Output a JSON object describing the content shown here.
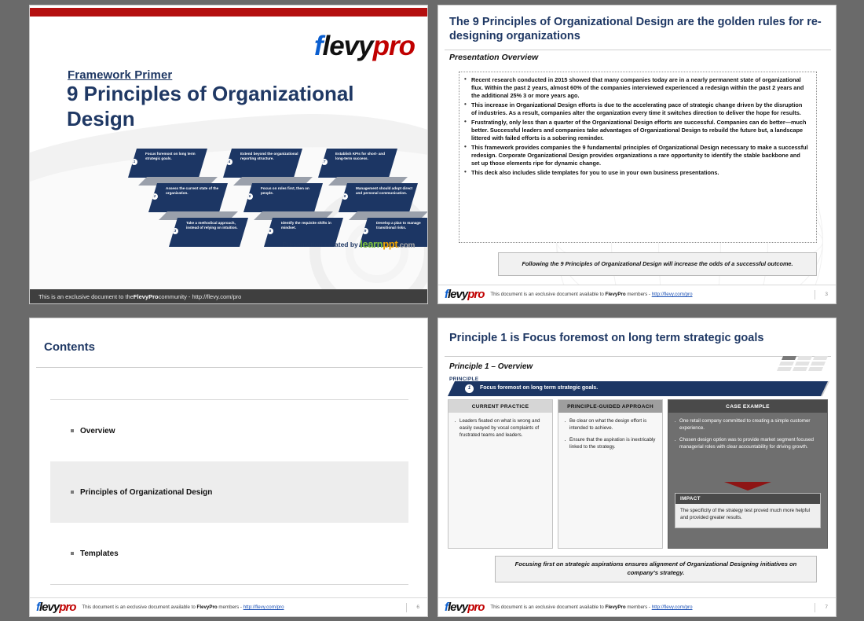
{
  "brand": {
    "flevy_f": "f",
    "flevy_levy": "levy",
    "flevy_pro": "pro",
    "learn": "learn",
    "ppt": "ppt",
    "dotcom": ".com",
    "accent_navy": "#1f3864",
    "accent_red": "#b40f0f",
    "accent_blue": "#0b5fd0"
  },
  "slide1": {
    "kicker": "Framework Primer",
    "title": "9 Principles of Organizational Design",
    "created_by": "Presentation created by",
    "footer": "This is an exclusive document to the FlevyPro community - http://flevy.com/pro",
    "footer_plain_1": "This is an exclusive document to the ",
    "footer_bold": "FlevyPro",
    "footer_plain_2": " community - http://flevy.com/pro",
    "principles": [
      {
        "num": "1",
        "text": "Focus foremost on long term strategic goals."
      },
      {
        "num": "4",
        "text": "Extend beyond the organizational reporting structure."
      },
      {
        "num": "7",
        "text": "Establish KPIs for short- and long-term success."
      },
      {
        "num": "2",
        "text": "Assess the current state of the organization."
      },
      {
        "num": "5",
        "text": "Focus on roles first, then on people."
      },
      {
        "num": "8",
        "text": "Management should adopt direct and personal communication."
      },
      {
        "num": "3",
        "text": "Take a methodical approach, instead of relying on intuition."
      },
      {
        "num": "6",
        "text": "Identify the requisite shifts in mindset."
      },
      {
        "num": "9",
        "text": "Develop a plan to manage transitional risks."
      }
    ]
  },
  "slide2": {
    "title": "The 9 Principles of Organizational Design are the golden rules for re-designing organizations",
    "subtitle": "Presentation Overview",
    "bullets": [
      "Recent research conducted in 2015 showed that many companies today are in a nearly permanent state of organizational flux.  Within the past 2 years, almost 60% of the companies interviewed experienced a redesign within the past 2 years and the additional 25% 3 or more years ago.",
      "This increase in Organizational Design efforts is due to the accelerating pace of strategic change driven by the disruption of industries. As a result, companies alter the organization every time it switches direction to deliver the hope for results.",
      "Frustratingly, only less than a quarter of the Organizational Design efforts are successful. Companies can do better—much better. Successful leaders and companies take advantages of Organizational Design to rebuild the future but, a landscape littered with failed efforts is a sobering reminder.",
      "This framework provides companies the 9 fundamental principles of Organizational Design necessary to make a successful redesign. Corporate Organizational Design provides organizations a rare opportunity to identify the stable backbone and set up those elements ripe for dynamic change.",
      "This deck also includes slide templates for you to use in your own business presentations."
    ],
    "takeaway": "Following the 9 Principles of Organizational Design will increase the odds of a successful outcome.",
    "footer_plain_1": "This document is an exclusive document available to ",
    "footer_bold": "FlevyPro",
    "footer_plain_2": " members - ",
    "footer_link": "http://flevy.com/pro",
    "page_number": "3"
  },
  "slide3": {
    "title": "Contents",
    "items": [
      {
        "label": "Overview",
        "highlighted": false
      },
      {
        "label": "Principles of Organizational Design",
        "highlighted": true
      },
      {
        "label": "Templates",
        "highlighted": false
      }
    ],
    "footer_plain_1": "This document is an exclusive document available to ",
    "footer_bold": "FlevyPro",
    "footer_plain_2": " members - ",
    "footer_link": "http://flevy.com/pro",
    "page_number": "6"
  },
  "slide4": {
    "title": "Principle 1 is Focus foremost on long term strategic goals",
    "subtitle": "Principle 1 – Overview",
    "principle_label": "PRINCIPLE",
    "principle_number": "1",
    "principle_text": "Focus foremost on long term strategic goals.",
    "columns": [
      {
        "header": "CURRENT PRACTICE",
        "bullets": [
          "Leaders fixated on what is wrong and easily swayed by vocal complaints of frustrated teams and leaders."
        ]
      },
      {
        "header": "PRINCIPLE-GUIDED APPROACH",
        "bullets": [
          "Be clear on what the design effort is intended to achieve.",
          "Ensure that the aspiration is inextricably linked to the strategy."
        ]
      },
      {
        "header": "CASE EXAMPLE",
        "bullets": [
          "One retail company committed to creating a simple customer experience.",
          "Chosen design option was to provide market segment focused managerial roles with clear accountability for driving growth."
        ]
      }
    ],
    "impact_header": "IMPACT",
    "impact_text": "The specificity of the strategy test proved much more helpful and provided greater results.",
    "takeaway": "Focusing first on strategic aspirations ensures alignment of Organizational Designing initiatives on company's strategy.",
    "footer_plain_1": "This document is an exclusive document available to ",
    "footer_bold": "FlevyPro",
    "footer_plain_2": " members - ",
    "footer_link": "http://flevy.com/pro",
    "page_number": "7"
  }
}
